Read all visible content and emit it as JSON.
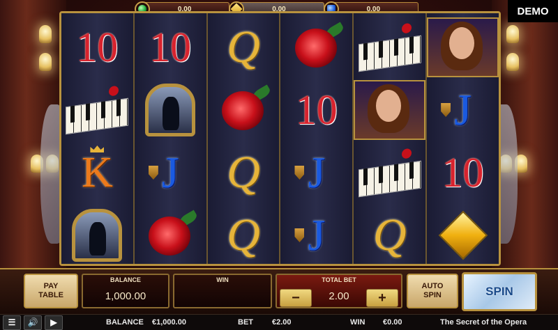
{
  "badge": {
    "demo": "DEMO"
  },
  "jackpots": [
    {
      "gem": "green-gem-icon",
      "value": "0.00"
    },
    {
      "gem": "gold-diamond-icon",
      "value": "0.00"
    },
    {
      "gem": "blue-gem-icon",
      "value": "0.00"
    }
  ],
  "reels": [
    [
      "10",
      "piano-rose",
      "K",
      "mirror"
    ],
    [
      "10",
      "mirror",
      "J",
      "rose"
    ],
    [
      "Q",
      "rose",
      "Q",
      "Q"
    ],
    [
      "rose",
      "10",
      "J",
      "J"
    ],
    [
      "piano-rose",
      "lady",
      "piano-rose",
      "Q"
    ],
    [
      "lady",
      "J",
      "10",
      "diamond"
    ]
  ],
  "panel": {
    "pay_table": "PAY\nTABLE",
    "balance_label": "BALANCE",
    "balance_value": "1,000.00",
    "win_label": "WIN",
    "win_value": "",
    "total_bet_label": "TOTAL BET",
    "total_bet_value": "2.00",
    "minus": "−",
    "plus": "+",
    "auto_spin": "AUTO\nSPIN",
    "spin": "SPIN"
  },
  "status": {
    "balance_label": "BALANCE",
    "balance_value": "€1,000.00",
    "bet_label": "BET",
    "bet_value": "€2.00",
    "win_label": "WIN",
    "win_value": "€0.00",
    "game_title": "The Secret of the Opera"
  },
  "colors": {
    "accent_gold": "#b8923e",
    "ten_red": "#d8232e",
    "jack_blue": "#1a5ae0",
    "queen_gold": "#e6b43a",
    "king_orange": "#ec7a1c"
  }
}
